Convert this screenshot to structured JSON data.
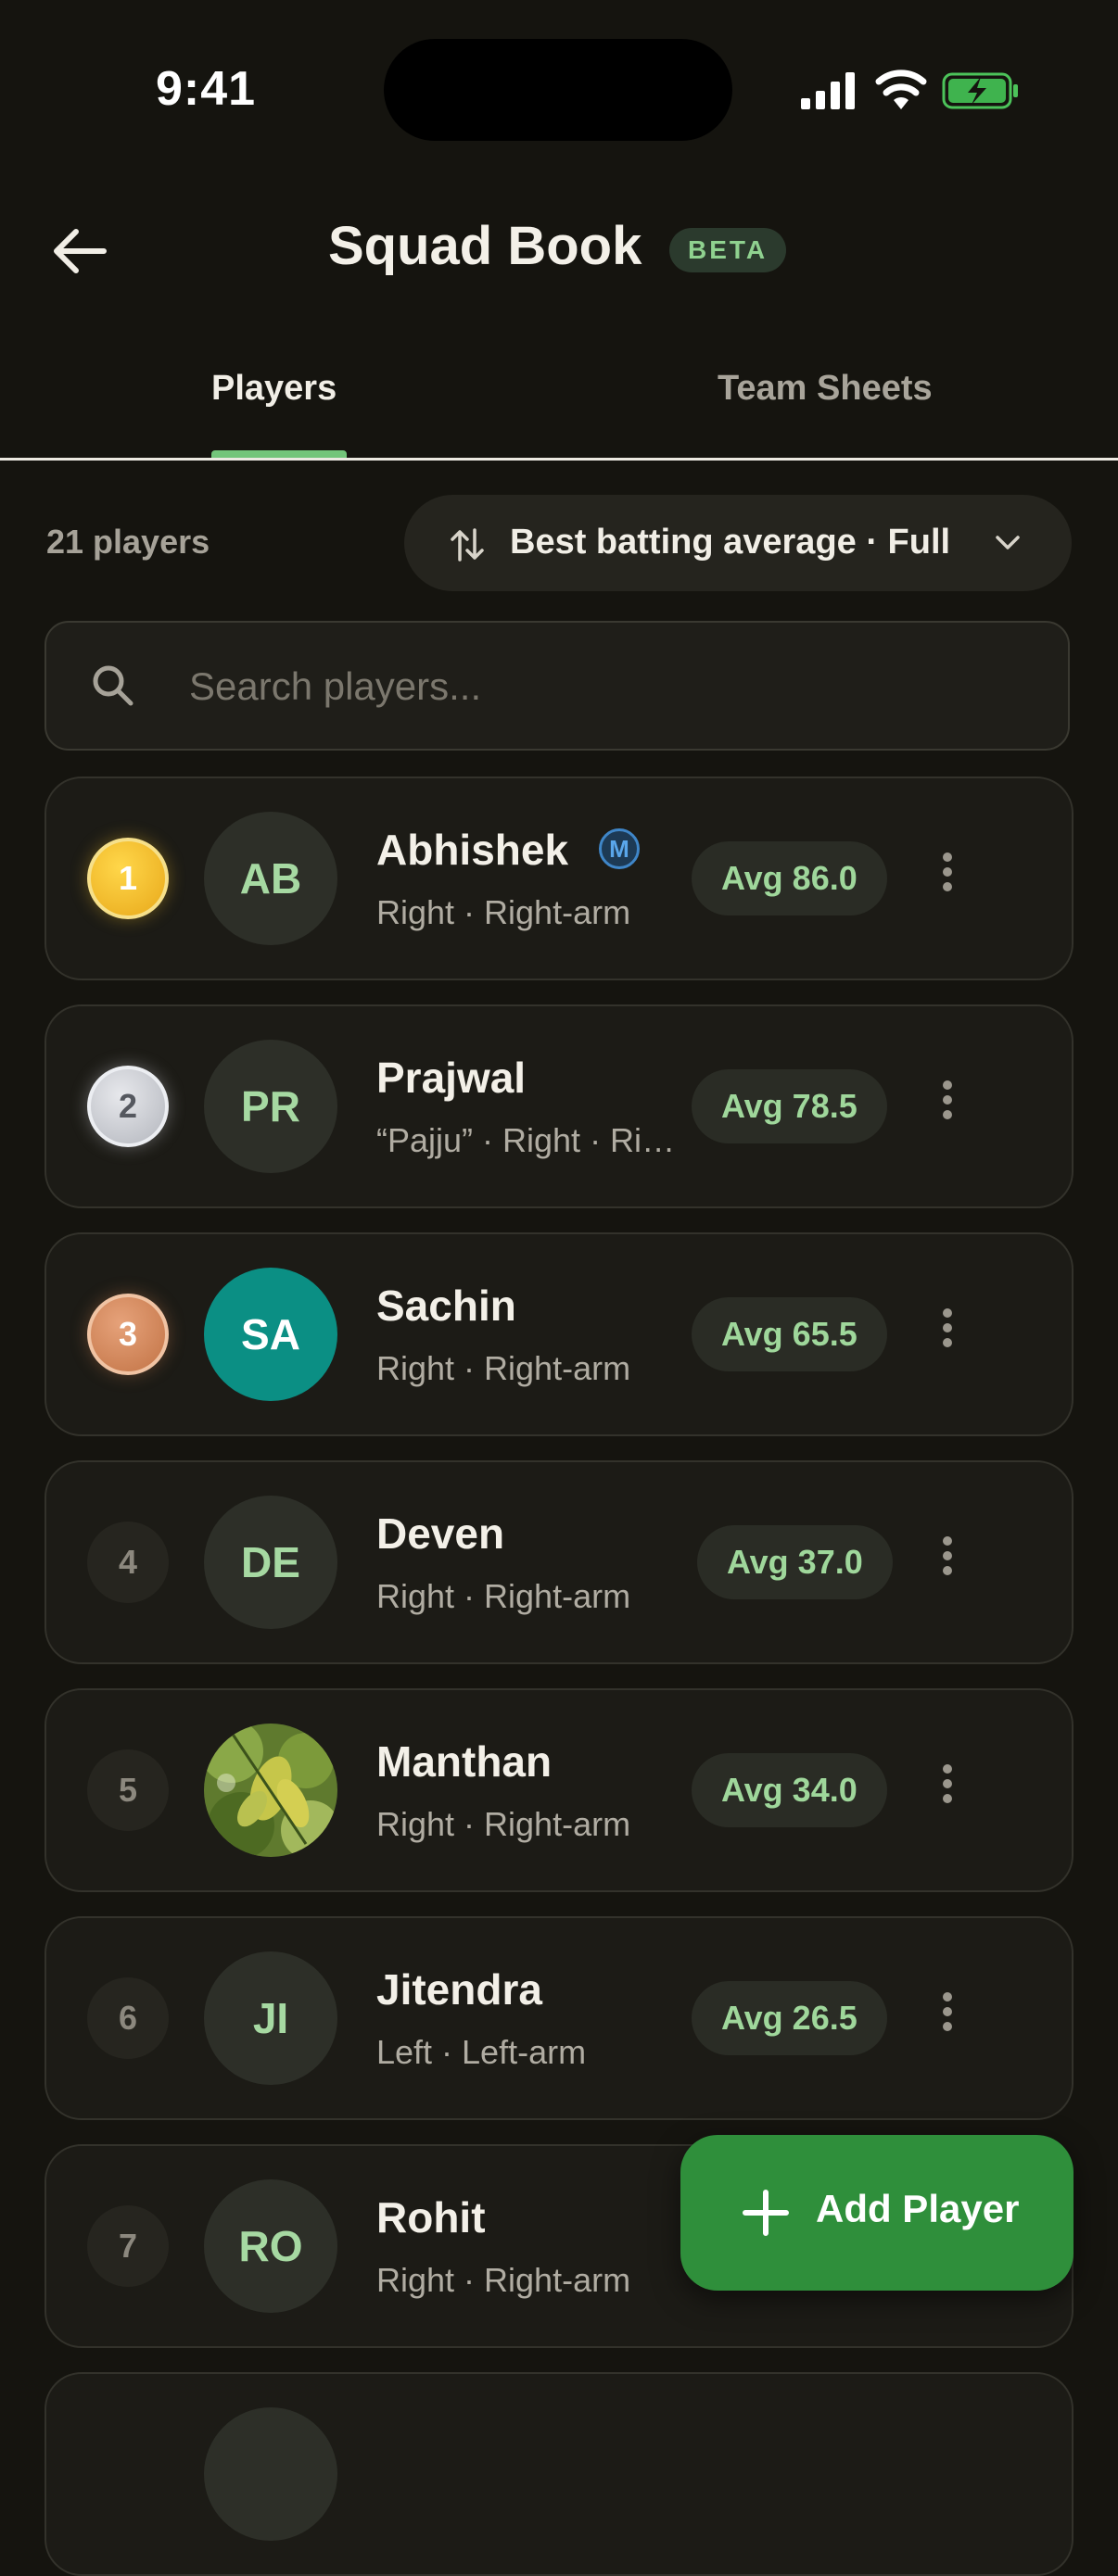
{
  "status_bar": {
    "time": "9:41"
  },
  "header": {
    "title": "Squad Book",
    "badge": "BETA"
  },
  "tabs": [
    {
      "label": "Players",
      "active": true
    },
    {
      "label": "Team Sheets",
      "active": false
    }
  ],
  "list": {
    "count_label": "21 players",
    "sort_label": "Best batting average · Full",
    "search_placeholder": "Search players..."
  },
  "players": [
    {
      "rank": "1",
      "initials": "AB",
      "name": "Abhishek",
      "badge": "M",
      "subtitle": "Right · Right-arm",
      "avg": "Avg 86.0"
    },
    {
      "rank": "2",
      "initials": "PR",
      "name": "Prajwal",
      "subtitle": "“Pajju” · Right · Right-arm",
      "avg": "Avg 78.5"
    },
    {
      "rank": "3",
      "initials": "SA",
      "name": "Sachin",
      "subtitle": "Right · Right-arm",
      "avg": "Avg 65.5"
    },
    {
      "rank": "4",
      "initials": "DE",
      "name": "Deven",
      "subtitle": "Right · Right-arm",
      "avg": "Avg 37.0"
    },
    {
      "rank": "5",
      "initials": "",
      "name": "Manthan",
      "subtitle": "Right · Right-arm",
      "avg": "Avg 34.0"
    },
    {
      "rank": "6",
      "initials": "JI",
      "name": "Jitendra",
      "subtitle": "Left · Left-arm",
      "avg": "Avg 26.5"
    },
    {
      "rank": "7",
      "initials": "RO",
      "name": "Rohit",
      "subtitle": "Right · Right-arm",
      "avg": ""
    }
  ],
  "fab": {
    "label": "Add Player"
  },
  "colors": {
    "background": "#15140f",
    "accent": "#73c57a",
    "fab": "#2f8f3b",
    "gold": "#e8a81a",
    "silver": "#b3b6bd",
    "bronze": "#c27345",
    "teal_avatar": "#0b8f84"
  }
}
